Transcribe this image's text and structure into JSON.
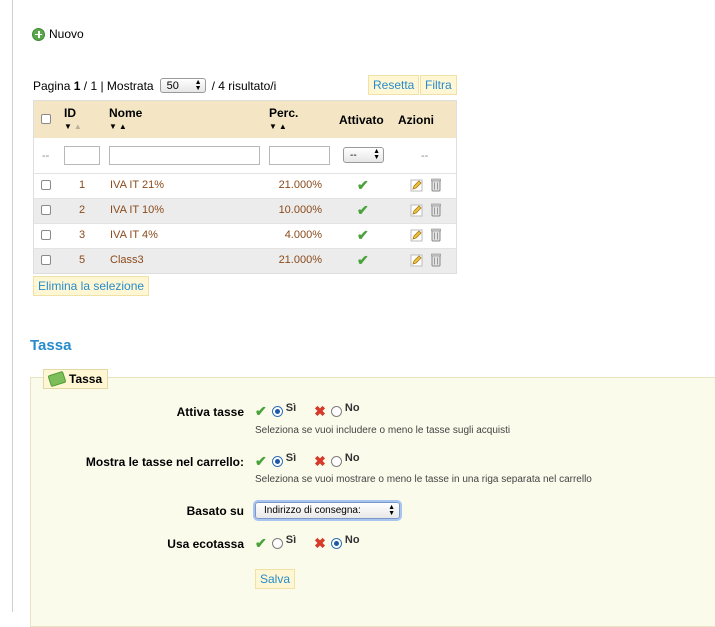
{
  "toolbar": {
    "new_label": "Nuovo"
  },
  "pager": {
    "page_label": "Pagina",
    "current_page": "1",
    "separator": "/",
    "total_pages": "1",
    "shown_label": "| Mostrata",
    "per_page": "50",
    "results": "/ 4 risultato/i"
  },
  "buttons": {
    "reset": "Resetta",
    "filter": "Filtra",
    "delete_selection": "Elimina la selezione",
    "save": "Salva"
  },
  "table": {
    "headers": {
      "id": "ID",
      "name": "Nome",
      "perc": "Perc.",
      "active": "Attivato",
      "actions": "Azioni"
    },
    "filter": {
      "placeholder_dash": "--",
      "active_select": "--",
      "actions_dash": "--"
    },
    "rows": [
      {
        "id": "1",
        "name": "IVA IT 21%",
        "perc": "21.000%"
      },
      {
        "id": "2",
        "name": "IVA IT 10%",
        "perc": "10.000%"
      },
      {
        "id": "3",
        "name": "IVA IT 4%",
        "perc": "4.000%"
      },
      {
        "id": "5",
        "name": "Class3",
        "perc": "21.000%"
      }
    ]
  },
  "tax": {
    "section_title": "Tassa",
    "legend": "Tassa",
    "yes": "Sì",
    "no": "No",
    "fields": [
      {
        "label": "Attiva tasse",
        "selected": "yes",
        "hint": "Seleziona se vuoi includere o meno le tasse sugli acquisti"
      },
      {
        "label": "Mostra le tasse nel carrello:",
        "selected": "yes",
        "hint": "Seleziona se vuoi mostrare o meno le tasse in una riga separata nel carrello"
      },
      {
        "label": "Basato su",
        "value": "Indirizzo di consegna:"
      },
      {
        "label": "Usa ecotassa",
        "selected": "no"
      }
    ]
  },
  "colors": {
    "link_blue": "#268ccd",
    "header_bg": "#f4e6c5",
    "row_text": "#8a4a1c",
    "button_bg": "#fff6d3"
  }
}
